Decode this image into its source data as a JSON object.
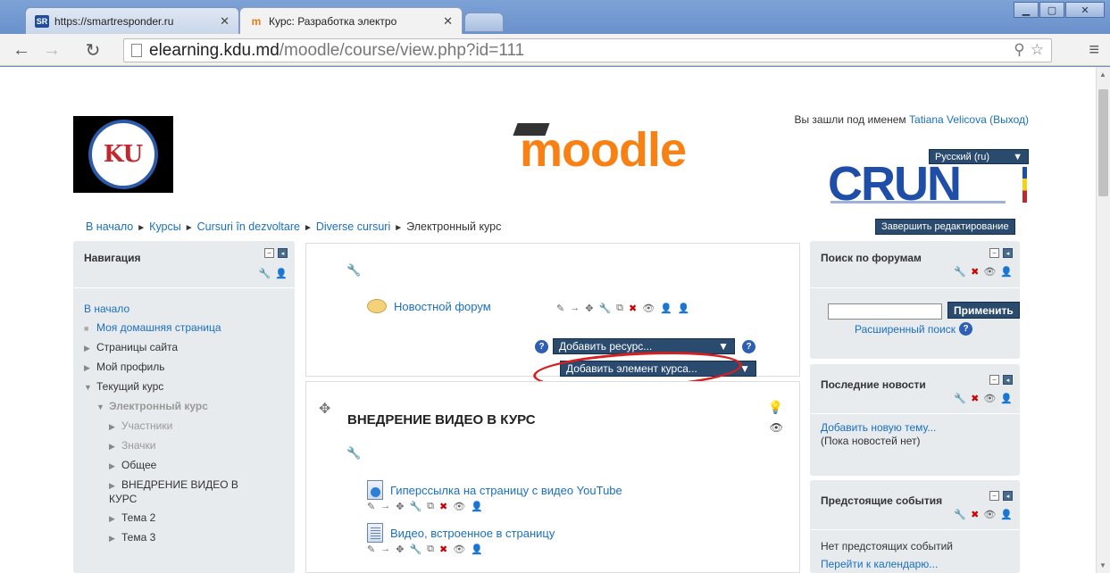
{
  "browser": {
    "tabs": [
      {
        "label": "https://smartresponder.ru",
        "favicon": "SR"
      },
      {
        "label": "Курс: Разработка электро",
        "favicon": "m"
      }
    ],
    "url_domain": "elearning.kdu.md",
    "url_path": "/moodle/course/view.php?id=111"
  },
  "header": {
    "login_prefix": "Вы зашли под именем",
    "user": "Tatiana Velicova",
    "logout": "(Выход)",
    "language": "Русский (ru)",
    "moodle_logo": "moodle",
    "crun_logo": "CRUN",
    "kdu_logo": "KU"
  },
  "breadcrumb": [
    "В начало",
    "Курсы",
    "Cursuri în dezvoltare",
    "Diverse cursuri",
    "Электронный курс"
  ],
  "finish_editing": "Завершить редактирование",
  "navigation": {
    "title": "Навигация",
    "home": "В начало",
    "items": [
      {
        "label": "Моя домашняя страница",
        "type": "link"
      },
      {
        "label": "Страницы сайта",
        "type": "node"
      },
      {
        "label": "Мой профиль",
        "type": "node"
      },
      {
        "label": "Текущий курс",
        "type": "node-open"
      },
      {
        "label": "Электронный курс",
        "type": "sub-open"
      },
      {
        "label": "Участники",
        "type": "sub2-grey"
      },
      {
        "label": "Значки",
        "type": "sub2-grey"
      },
      {
        "label": "Общее",
        "type": "sub2"
      },
      {
        "label": "ВНЕДРЕНИЕ ВИДЕО В КУРС",
        "type": "sub2"
      },
      {
        "label": "Тема 2",
        "type": "sub2"
      },
      {
        "label": "Тема 3",
        "type": "sub2"
      }
    ]
  },
  "section0": {
    "forum": "Новостной форум",
    "add_resource": "Добавить ресурс...",
    "add_activity": "Добавить элемент курса..."
  },
  "section1": {
    "title": "ВНЕДРЕНИЕ ВИДЕО В КУРС",
    "items": [
      "Гиперссылка на страницу с видео YouTube",
      "Видео, встроенное в страницу"
    ]
  },
  "forum_search": {
    "title": "Поиск по форумам",
    "apply": "Применить",
    "advanced": "Расширенный поиск"
  },
  "latest_news": {
    "title": "Последние новости",
    "add_topic": "Добавить новую тему...",
    "no_news": "(Пока новостей нет)"
  },
  "upcoming": {
    "title": "Предстоящие события",
    "none": "Нет предстоящих событий",
    "calendar": "Перейти к календарю..."
  }
}
